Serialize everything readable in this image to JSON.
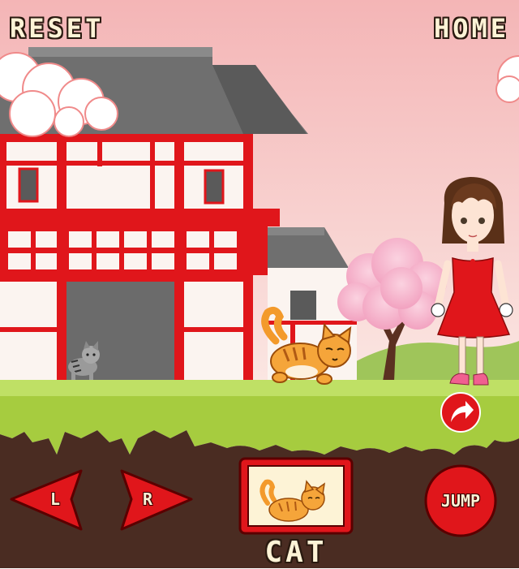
{
  "hud": {
    "reset_label": "RESET",
    "home_label": "HOME"
  },
  "controls": {
    "left_label": "L",
    "right_label": "R",
    "jump_label": "JUMP"
  },
  "character_selector": {
    "current_label": "CAT"
  },
  "scene": {
    "characters": [
      "orange-cat",
      "grey-tabby-kitten",
      "girl-in-red-dress"
    ],
    "background": "japanese-house-with-cherry-blossom"
  },
  "colors": {
    "sky": "#f6c3c3",
    "grass": "#a6cc3f",
    "soil": "#4a2c22",
    "accent_red": "#e0161b",
    "cream": "#fdf3d6"
  }
}
